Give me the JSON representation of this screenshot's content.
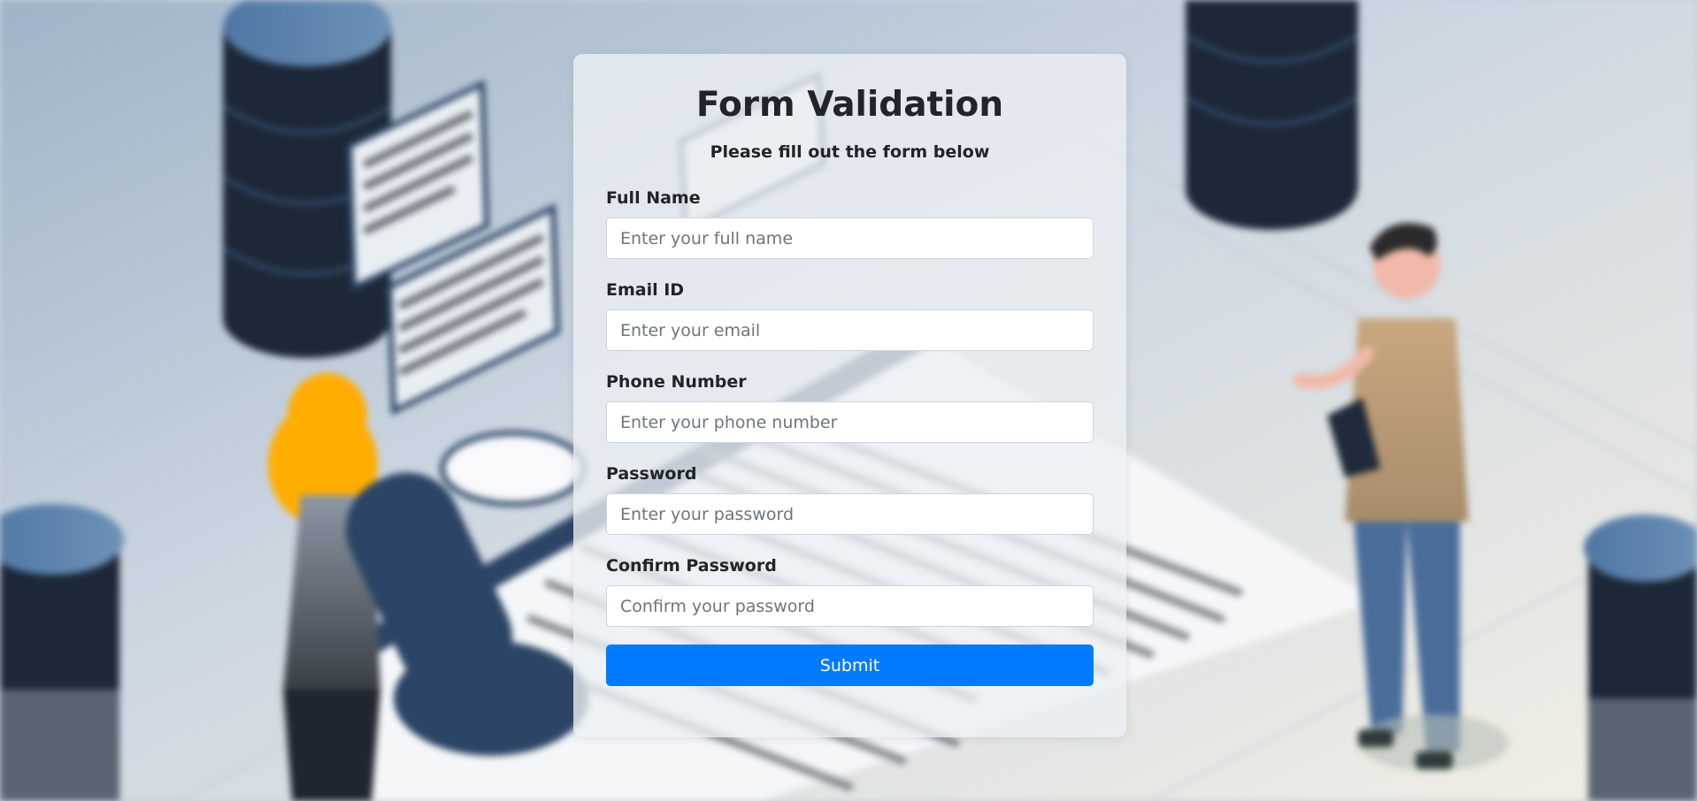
{
  "form": {
    "title": "Form Validation",
    "subtitle": "Please fill out the form below",
    "fields": [
      {
        "label": "Full Name",
        "placeholder": "Enter your full name",
        "value": ""
      },
      {
        "label": "Email ID",
        "placeholder": "Enter your email",
        "value": ""
      },
      {
        "label": "Phone Number",
        "placeholder": "Enter your phone number",
        "value": ""
      },
      {
        "label": "Password",
        "placeholder": "Enter your password",
        "value": ""
      },
      {
        "label": "Confirm Password",
        "placeholder": "Confirm your password",
        "value": ""
      }
    ],
    "submit_label": "Submit"
  },
  "colors": {
    "accent": "#007bff",
    "text": "#212529",
    "card_background": "#eceff4",
    "input_border": "#ced4da"
  }
}
